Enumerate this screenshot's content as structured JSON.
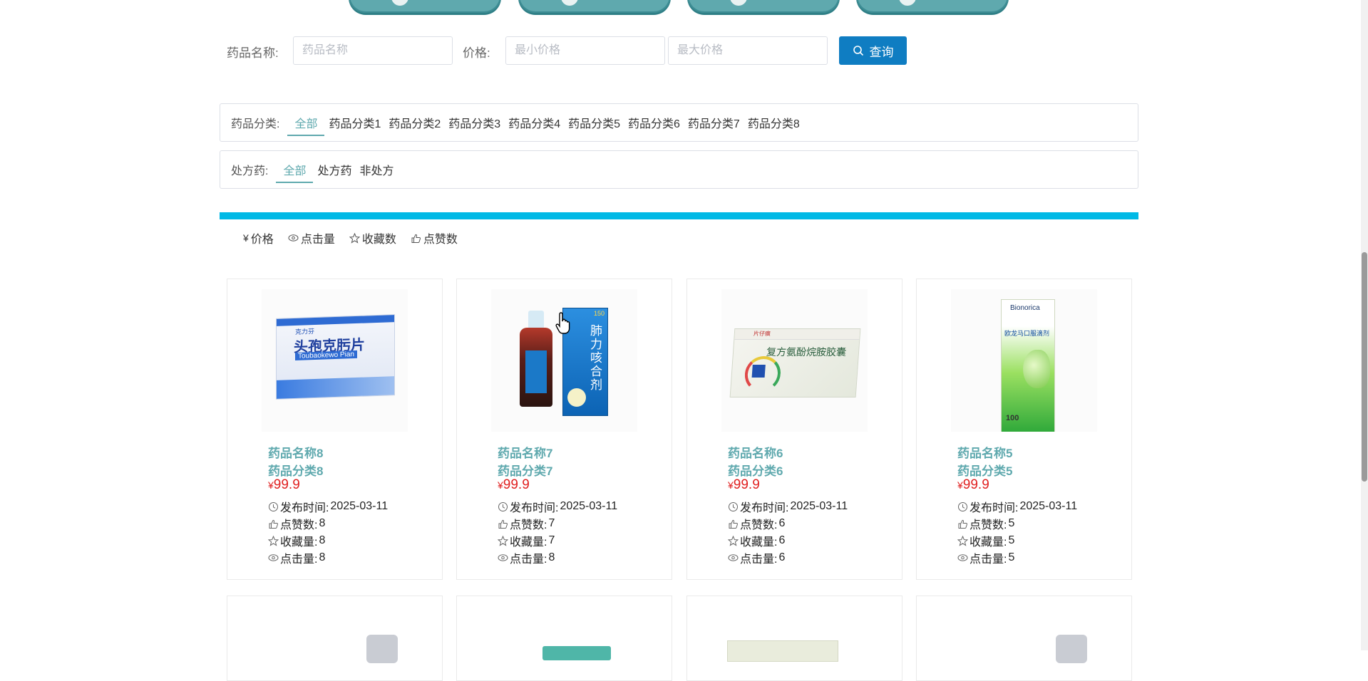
{
  "search": {
    "name_label": "药品名称:",
    "name_placeholder": "药品名称",
    "price_label": "价格:",
    "min_placeholder": "最小价格",
    "max_placeholder": "最大价格",
    "button_label": "查询"
  },
  "category_filter": {
    "label": "药品分类:",
    "items": [
      "全部",
      "药品分类1",
      "药品分类2",
      "药品分类3",
      "药品分类4",
      "药品分类5",
      "药品分类6",
      "药品分类7",
      "药品分类8"
    ],
    "active": "全部"
  },
  "rx_filter": {
    "label": "处方药:",
    "items": [
      "全部",
      "处方药",
      "非处方"
    ],
    "active": "全部"
  },
  "sort": {
    "price": "价格",
    "clicks": "点击量",
    "favorites": "收藏数",
    "likes": "点赞数"
  },
  "labels": {
    "publish": "发布时间:",
    "likes": "点赞数:",
    "favorites": "收藏量:",
    "clicks": "点击量:",
    "currency": "¥"
  },
  "products": [
    {
      "name": "药品名称8",
      "category": "药品分类8",
      "price": "99.9",
      "date": "2025-03-11",
      "likes": "8",
      "favorites": "8",
      "clicks": "8",
      "box_text": "头孢克肟片",
      "box_sub": "Toubaokewo Pian",
      "brand": "克力芬"
    },
    {
      "name": "药品名称7",
      "category": "药品分类7",
      "price": "99.9",
      "date": "2025-03-11",
      "likes": "7",
      "favorites": "7",
      "clicks": "8",
      "box_text": "肺力咳合剂",
      "box_sub": "150",
      "brand": ""
    },
    {
      "name": "药品名称6",
      "category": "药品分类6",
      "price": "99.9",
      "date": "2025-03-11",
      "likes": "6",
      "favorites": "6",
      "clicks": "6",
      "box_text": "复方氨酚烷胺胶囊",
      "box_sub": "",
      "brand": "片仔癀"
    },
    {
      "name": "药品名称5",
      "category": "药品分类5",
      "price": "99.9",
      "date": "2025-03-11",
      "likes": "5",
      "favorites": "5",
      "clicks": "5",
      "box_text": "欧龙马口服滴剂",
      "box_sub": "100",
      "brand": "Bionorica"
    }
  ],
  "colors": {
    "accent": "#5fa9ae",
    "primary_button": "#0f7dc2",
    "price": "#e02020",
    "bar": "#00b9e6"
  }
}
